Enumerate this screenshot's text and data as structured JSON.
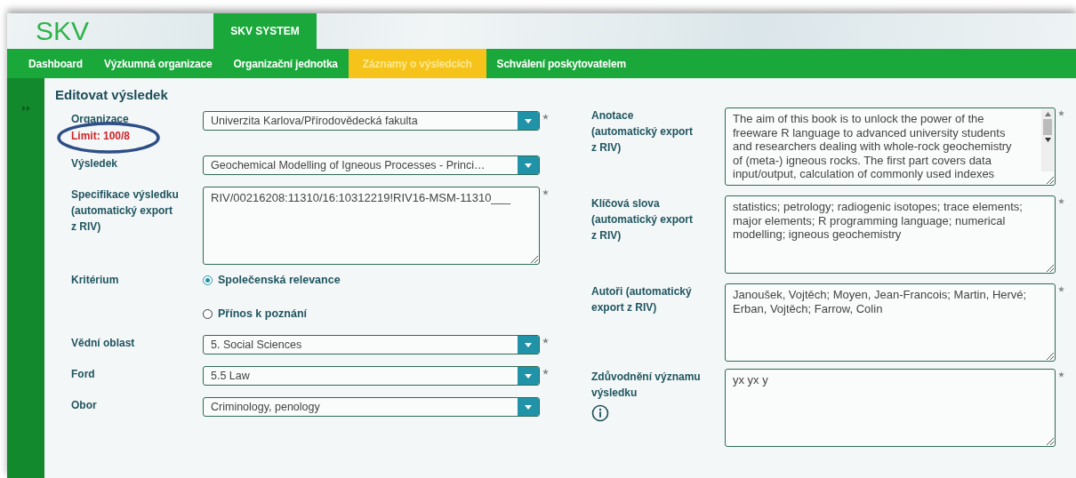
{
  "header": {
    "logo": "SKV",
    "system_tab": "SKV SYSTEM"
  },
  "nav": [
    {
      "label": "Dashboard",
      "selected": false
    },
    {
      "label": "Výzkumná organizace",
      "selected": false
    },
    {
      "label": "Organizační jednotka",
      "selected": false
    },
    {
      "label": "Záznamy o výsledcích",
      "selected": true
    },
    {
      "label": "Schválení poskytovatelem",
      "selected": false
    }
  ],
  "page_title": "Editovat výsledek",
  "left_fields": [
    {
      "kind": "select",
      "label": "Organizace",
      "note": "Limit: 100/8",
      "note_highlighted": true,
      "value": "Univerzita Karlova/Přírodovědecká fakulta",
      "required": true
    },
    {
      "kind": "select",
      "label": "Výsledek",
      "value": "Geochemical Modelling of Igneous Processes - Princi…",
      "required": false
    },
    {
      "kind": "textarea",
      "label": "Specifikace výsledku\n(automatický export\nz RIV)",
      "value": "RIV/00216208:11310/16:10312219!RIV16-MSM-11310___",
      "required": true
    },
    {
      "kind": "radio",
      "label": "Kritérium",
      "required": false,
      "options": [
        {
          "label": "Společenská relevance",
          "selected": true
        },
        {
          "label": "Přínos k poznání",
          "selected": false
        }
      ]
    },
    {
      "kind": "select",
      "label": "Vědní oblast",
      "value": "5. Social Sciences",
      "required": true
    },
    {
      "kind": "select",
      "label": "Ford",
      "value": "5.5 Law",
      "required": true
    },
    {
      "kind": "select",
      "label": "Obor",
      "value": "Criminology, penology",
      "required": false
    }
  ],
  "right_fields": [
    {
      "kind": "textarea",
      "label": "Anotace\n(automatický export\nz RIV)",
      "value": "The aim of this book is to unlock the power of the freeware R language to advanced university students and researchers dealing with whole-rock geochemistry of (meta-) igneous rocks. The first part covers data input/output, calculation of commonly used indexes",
      "required": true,
      "scrollbar": true
    },
    {
      "kind": "textarea",
      "label": "Klíčová slova\n(automatický export\nz RIV)",
      "value": "statistics; petrology; radiogenic isotopes; trace elements; major elements; R programming language; numerical modelling; igneous geochemistry",
      "required": true
    },
    {
      "kind": "textarea",
      "label": "Autoři (automatický export z RIV)",
      "value": "Janoušek, Vojtěch; Moyen, Jean-Francois; Martin, Hervé; Erban, Vojtěch; Farrow, Colin",
      "required": true
    },
    {
      "kind": "textarea",
      "label": "Zdůvodnění významu výsledku",
      "value": "yx yx y",
      "required": true,
      "info": true
    }
  ]
}
